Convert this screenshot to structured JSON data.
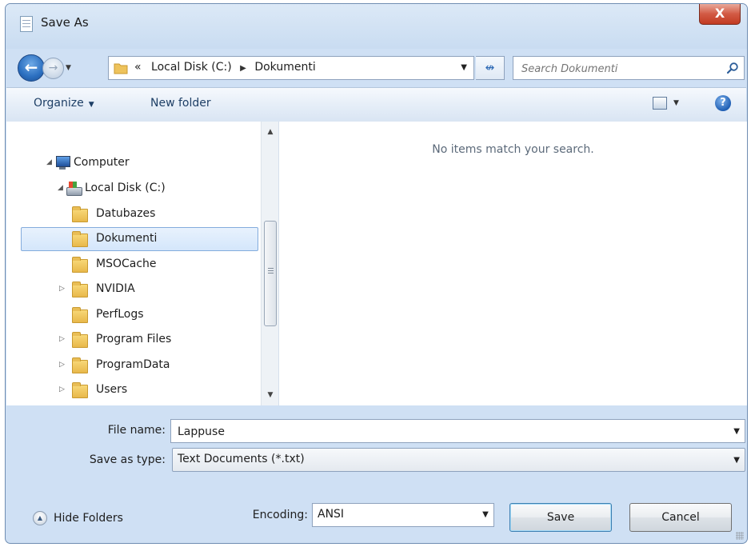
{
  "window": {
    "title": "Save As",
    "close_label": "X"
  },
  "address": {
    "crumb_prefix": "«",
    "crumbs": [
      "Local Disk (C:)",
      "Dokumenti"
    ],
    "search_placeholder": "Search Dokumenti"
  },
  "toolbar": {
    "organize_label": "Organize",
    "new_folder_label": "New folder",
    "help_label": "?"
  },
  "nav_tree": {
    "items": [
      {
        "label": "Computer",
        "icon": "computer-icon",
        "expander": "◢"
      },
      {
        "label": "Local Disk (C:)",
        "icon": "disk-icon",
        "expander": "◢"
      },
      {
        "label": "Datubazes",
        "icon": "folder-icon",
        "expander": ""
      },
      {
        "label": "Dokumenti",
        "icon": "folder-icon",
        "expander": "",
        "selected": true
      },
      {
        "label": "MSOCache",
        "icon": "folder-icon",
        "expander": ""
      },
      {
        "label": "NVIDIA",
        "icon": "folder-icon",
        "expander": "▷"
      },
      {
        "label": "PerfLogs",
        "icon": "folder-icon",
        "expander": ""
      },
      {
        "label": "Program Files",
        "icon": "folder-icon",
        "expander": "▷"
      },
      {
        "label": "ProgramData",
        "icon": "folder-icon",
        "expander": "▷"
      },
      {
        "label": "Users",
        "icon": "folder-icon",
        "expander": "▷"
      }
    ]
  },
  "content": {
    "empty_message": "No items match your search."
  },
  "form": {
    "file_name_label": "File name:",
    "file_name_value": "Lappuse",
    "save_type_label": "Save as type:",
    "save_type_value": "Text Documents (*.txt)",
    "encoding_label": "Encoding:",
    "encoding_value": "ANSI"
  },
  "footer": {
    "hide_folders_label": "Hide Folders",
    "save_label": "Save",
    "cancel_label": "Cancel"
  },
  "colors": {
    "window_frame": "#cfe0f4",
    "selection": "#d4e6fb",
    "close_button": "#c23b22"
  }
}
